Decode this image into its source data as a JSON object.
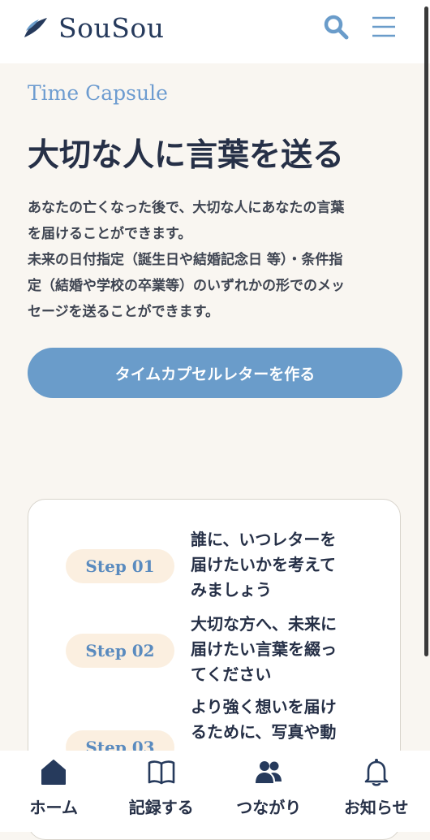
{
  "header": {
    "brand": "SouSou",
    "search_icon": "search-icon",
    "menu_icon": "hamburger-menu-icon",
    "accent_color": "#6a9cca",
    "brand_color": "#263a5c"
  },
  "hero": {
    "eyebrow": "Time Capsule",
    "title": "大切な人に言葉を送る",
    "description_lines": [
      "あなたの亡くなった後で、大切な人にあなたの言葉",
      "を届けることができます。",
      "未来の日付指定（誕生日や結婚記念日 等）・条件指",
      "定（結婚や学校の卒業等）のいずれかの形でのメッ",
      "セージを送ることができます。"
    ],
    "cta_label": "タイムカプセルレターを作る"
  },
  "steps": [
    {
      "label": "Step 01",
      "lines": [
        "誰に、いつレターを",
        "届けたいかを考えて",
        "みましょう"
      ]
    },
    {
      "label": "Step 02",
      "lines": [
        "大切な方へ、未来に",
        "届けたい言葉を綴っ",
        "てください"
      ]
    },
    {
      "label": "Step 03",
      "lines": [
        "より強く想いを届け",
        "るために、写真や動"
      ]
    }
  ],
  "bottom_nav": [
    {
      "label": "ホーム",
      "icon": "home-icon",
      "active": true
    },
    {
      "label": "記録する",
      "icon": "book-icon",
      "active": false
    },
    {
      "label": "つながり",
      "icon": "people-icon",
      "active": false
    },
    {
      "label": "お知らせ",
      "icon": "bell-icon",
      "active": false
    }
  ]
}
